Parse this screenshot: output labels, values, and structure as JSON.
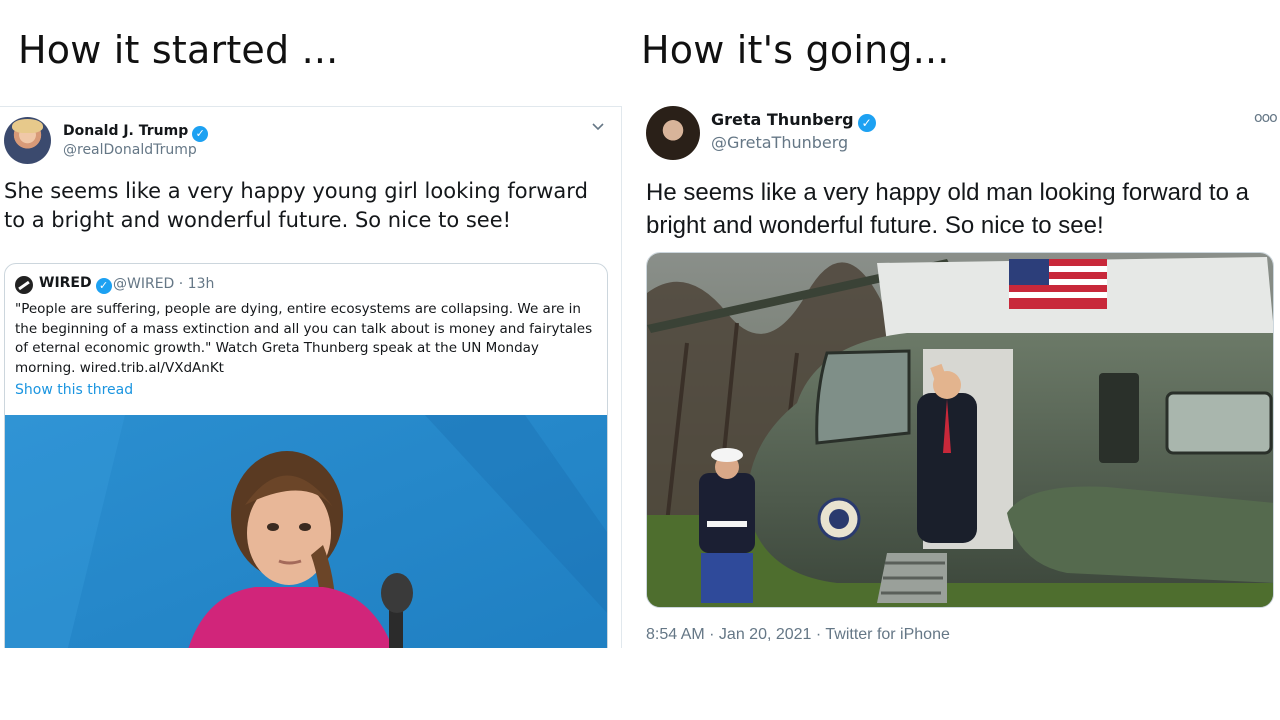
{
  "headings": {
    "left": "How it started ...",
    "right": "How it's going..."
  },
  "left_tweet": {
    "author_name": "Donald J. Trump",
    "handle": "@realDonaldTrump",
    "text": "She seems like a very happy young girl looking forward to a bright and wonderful future. So nice to see!",
    "avatar_icon": "avatar-photo",
    "verified_icon": "verified-badge-icon",
    "menu_icon": "chevron-down-icon",
    "quoted_tweet": {
      "author_name": "WIRED",
      "handle_time": "@WIRED · 13h",
      "text": "\"People are suffering, people are dying, entire ecosystems are collapsing. We are in the beginning of a mass extinction and all you can talk about is money and fairytales of eternal economic growth.\" Watch Greta Thunberg speak at the UN Monday morning. wired.trib.al/VXdAnKt",
      "show_thread": "Show this thread"
    }
  },
  "right_tweet": {
    "author_name": "Greta Thunberg",
    "handle": "@GretaThunberg",
    "text": "He seems like a very happy old man looking forward to a bright and wonderful future. So nice to see!",
    "meta": "8:54 AM · Jan 20, 2021 · Twitter for iPhone",
    "more_icon": "more-options-icon"
  },
  "colors": {
    "twitter_blue": "#1da1f2",
    "link_blue": "#1b95e0",
    "secondary_text": "#657786",
    "border": "#e1e8ed"
  }
}
